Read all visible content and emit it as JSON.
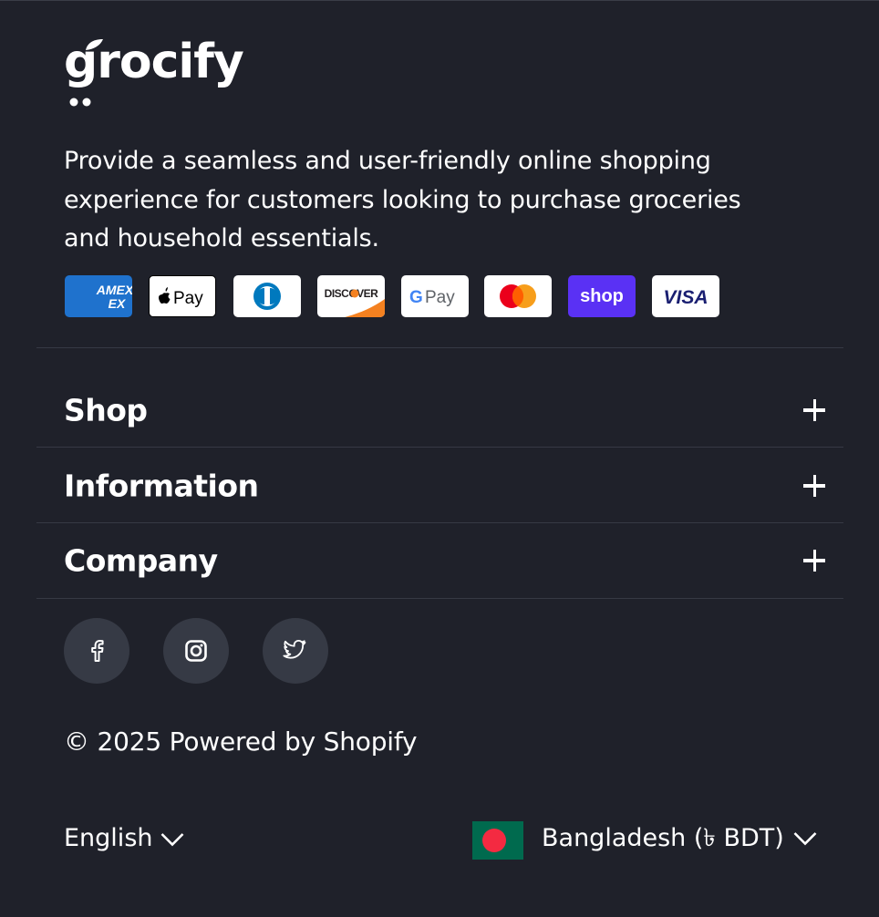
{
  "brand": {
    "logo_text": "grocify"
  },
  "footer": {
    "description": "Provide a seamless and user-friendly online shopping experience for customers looking to purchase groceries and household essentials.",
    "payment_methods": [
      {
        "name": "American Express",
        "icon": "amex-icon",
        "label": "AMEX"
      },
      {
        "name": "Apple Pay",
        "icon": "apple-pay-icon",
        "label": "Pay"
      },
      {
        "name": "Diners Club",
        "icon": "diners-club-icon"
      },
      {
        "name": "Discover",
        "icon": "discover-icon",
        "label": "DISCOVER"
      },
      {
        "name": "Google Pay",
        "icon": "google-pay-icon",
        "label": "Pay"
      },
      {
        "name": "Mastercard",
        "icon": "mastercard-icon"
      },
      {
        "name": "Shop Pay",
        "icon": "shop-pay-icon",
        "label": "shop"
      },
      {
        "name": "Visa",
        "icon": "visa-icon",
        "label": "VISA"
      }
    ],
    "accordion": [
      {
        "title": "Shop"
      },
      {
        "title": "Information"
      },
      {
        "title": "Company"
      }
    ],
    "social": [
      {
        "name": "Facebook",
        "icon": "facebook-icon"
      },
      {
        "name": "Instagram",
        "icon": "instagram-icon"
      },
      {
        "name": "Twitter",
        "icon": "twitter-icon"
      }
    ],
    "copyright": "© 2025 Powered by Shopify",
    "language": "English",
    "country": "Bangladesh (৳ BDT)"
  },
  "colors": {
    "background": "#1f212a",
    "divider": "#363944",
    "social_bg": "#363a45",
    "text": "#ffffff",
    "shop_pay": "#5a31f4",
    "amex": "#1f72cd",
    "flag_green": "#006a4e",
    "flag_red": "#f42a41"
  }
}
